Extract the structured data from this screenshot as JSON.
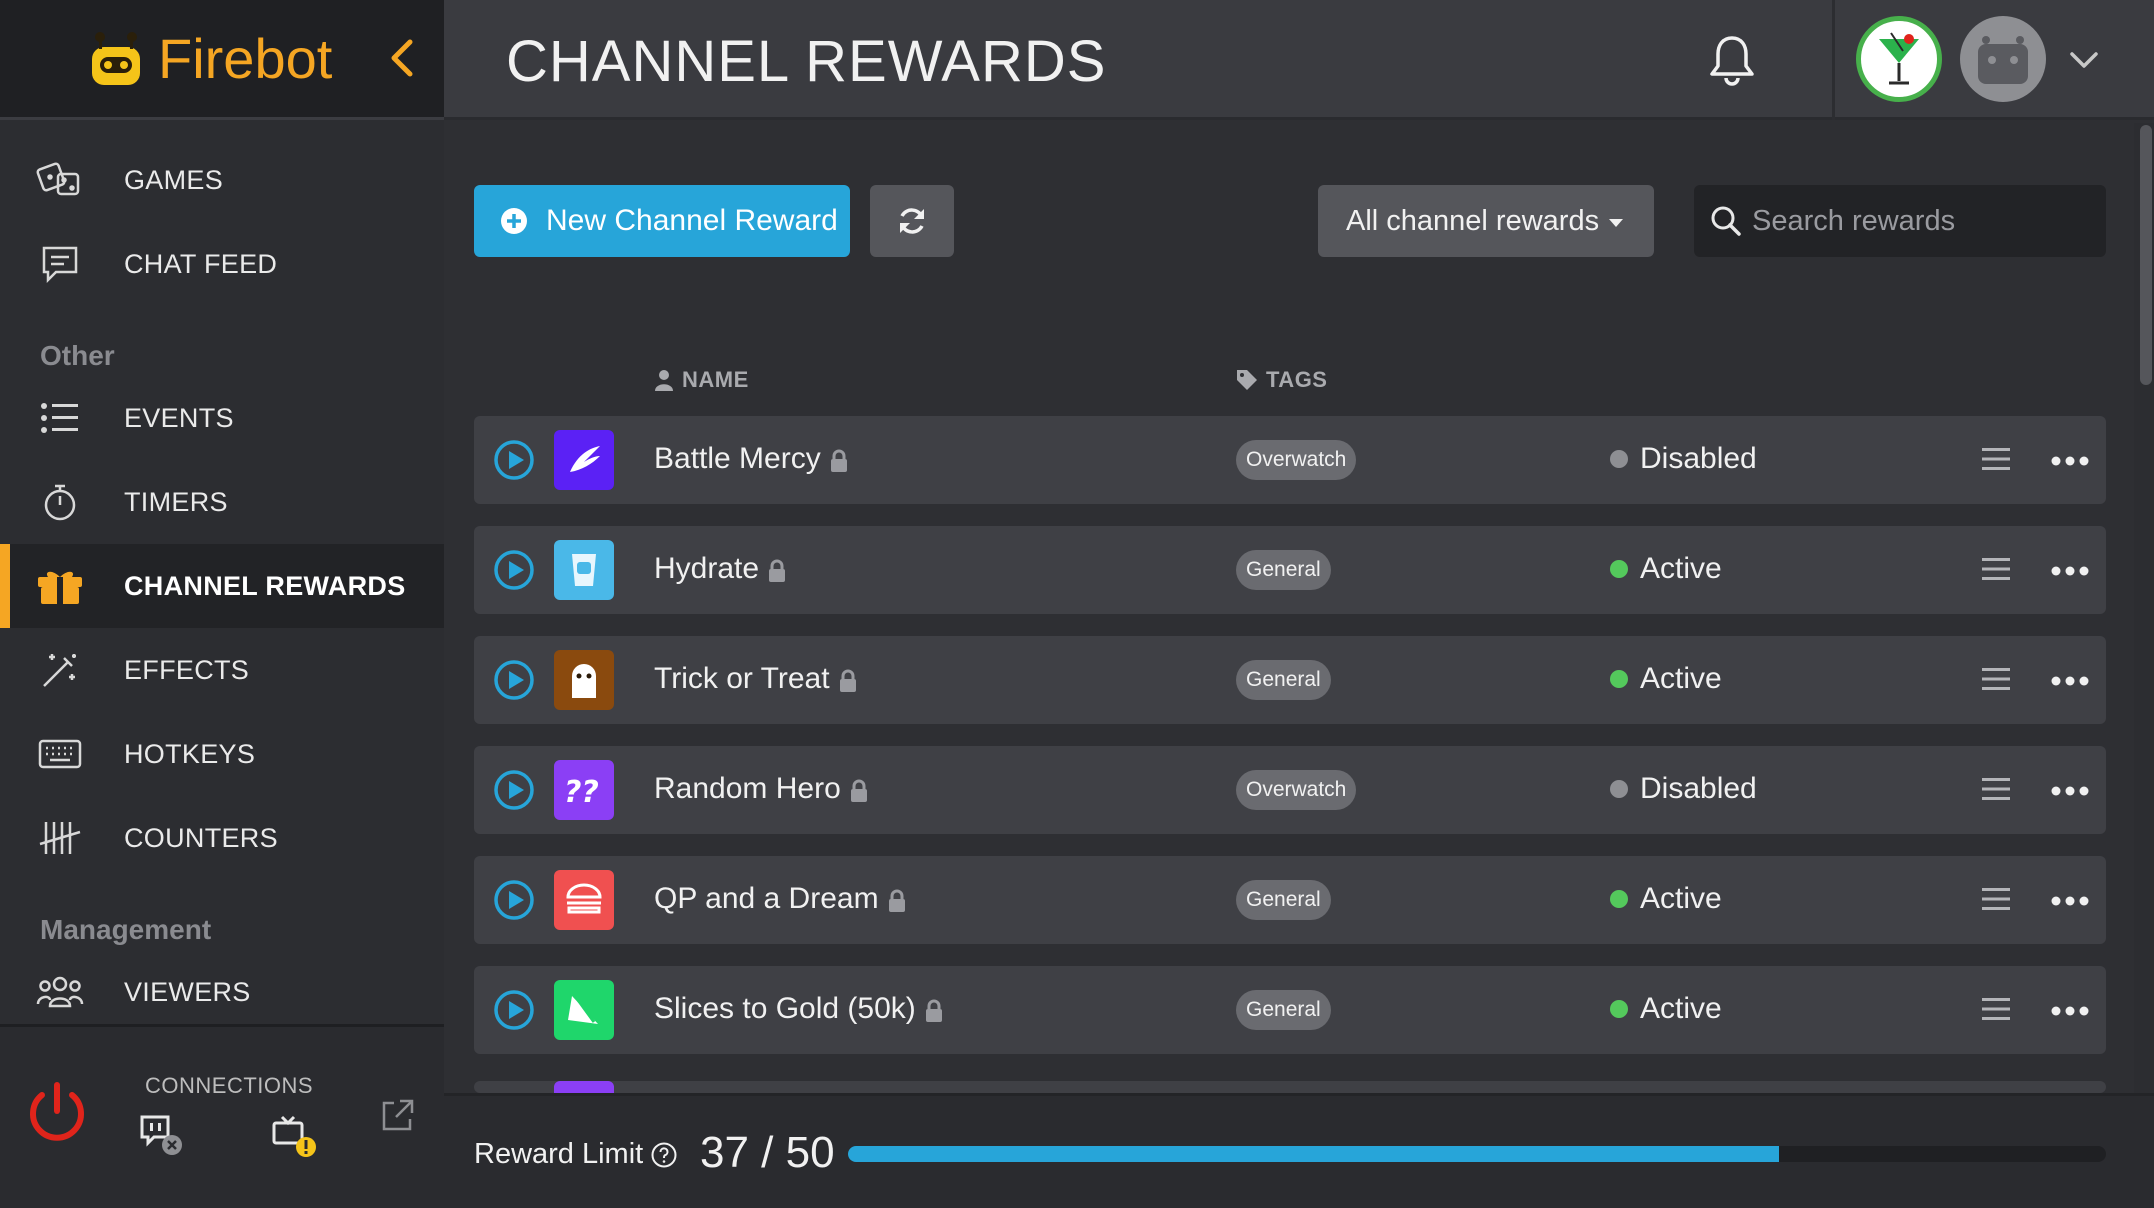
{
  "app": {
    "name": "Firebot"
  },
  "sidebar": {
    "items_top": [
      {
        "label": "GAMES",
        "icon": "dice-icon"
      },
      {
        "label": "CHAT FEED",
        "icon": "chat-icon"
      }
    ],
    "section_other": "Other",
    "items_other": [
      {
        "label": "EVENTS",
        "icon": "list-icon"
      },
      {
        "label": "TIMERS",
        "icon": "stopwatch-icon"
      },
      {
        "label": "CHANNEL REWARDS",
        "icon": "gift-icon"
      },
      {
        "label": "EFFECTS",
        "icon": "magic-wand-icon"
      },
      {
        "label": "HOTKEYS",
        "icon": "keyboard-icon"
      },
      {
        "label": "COUNTERS",
        "icon": "tally-icon"
      }
    ],
    "section_management": "Management",
    "items_management": [
      {
        "label": "VIEWERS",
        "icon": "users-icon"
      }
    ],
    "connections_label": "CONNECTIONS"
  },
  "header": {
    "title": "CHANNEL REWARDS"
  },
  "toolbar": {
    "new_label": "New Channel Reward",
    "filter_label": "All channel rewards",
    "search_placeholder": "Search rewards"
  },
  "columns": {
    "name": "NAME",
    "tags": "TAGS"
  },
  "rewards": [
    {
      "name": "Battle Mercy",
      "tag": "Overwatch",
      "status": "Disabled",
      "icon_color": "#5b21f5",
      "status_color": "#8e8f93",
      "icon": "wing-icon"
    },
    {
      "name": "Hydrate",
      "tag": "General",
      "status": "Active",
      "icon_color": "#4ab8e8",
      "status_color": "#54c95c",
      "icon": "water-glass-icon"
    },
    {
      "name": "Trick or Treat",
      "tag": "General",
      "status": "Active",
      "icon_color": "#8a4a0e",
      "status_color": "#54c95c",
      "icon": "ghost-icon"
    },
    {
      "name": "Random Hero",
      "tag": "Overwatch",
      "status": "Disabled",
      "icon_color": "#8b3ff5",
      "status_color": "#8e8f93",
      "icon": "question-marks-icon"
    },
    {
      "name": "QP and a Dream",
      "tag": "General",
      "status": "Active",
      "icon_color": "#f05050",
      "status_color": "#54c95c",
      "icon": "burger-icon"
    },
    {
      "name": "Slices to Gold (50k)",
      "tag": "General",
      "status": "Active",
      "icon_color": "#1fd66b",
      "status_color": "#54c95c",
      "icon": "pizza-slice-icon"
    }
  ],
  "reward_limit": {
    "label": "Reward Limit",
    "value": "37 / 50",
    "progress": 0.74
  },
  "colors": {
    "accent": "#f5a623",
    "primary": "#27a5d9"
  }
}
